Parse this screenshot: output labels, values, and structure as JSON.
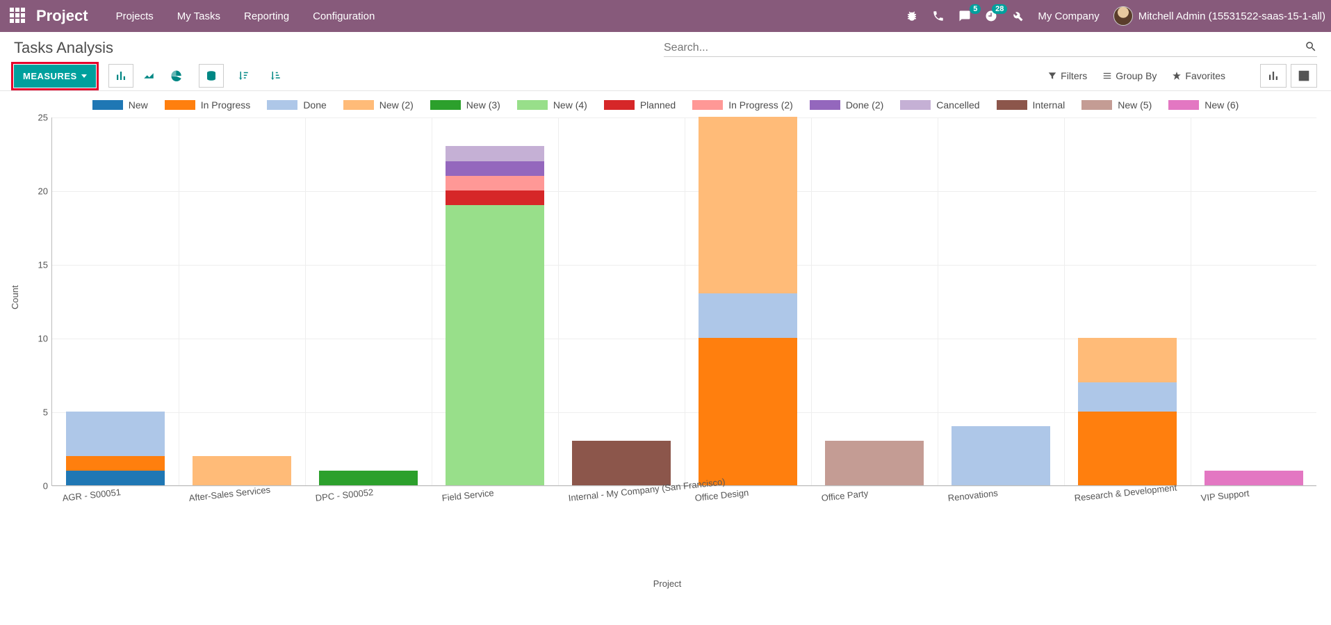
{
  "app": {
    "brand": "Project",
    "menu": [
      "Projects",
      "My Tasks",
      "Reporting",
      "Configuration"
    ],
    "systray": {
      "messaging_badge": "5",
      "activities_badge": "28",
      "company": "My Company",
      "user": "Mitchell Admin (15531522-saas-15-1-all)"
    }
  },
  "breadcrumb": "Tasks Analysis",
  "search": {
    "placeholder": "Search..."
  },
  "controls": {
    "measures_label": "MEASURES",
    "filters": "Filters",
    "groupby": "Group By",
    "favorites": "Favorites"
  },
  "legend_colors": {
    "New": "#1f77b4",
    "In Progress": "#ff7f0e",
    "Done": "#aec7e8",
    "New (2)": "#ffbb78",
    "New (3)": "#2ca02c",
    "New (4)": "#98df8a",
    "Planned": "#d62728",
    "In Progress (2)": "#ff9896",
    "Done (2)": "#9467bd",
    "Cancelled": "#c5b0d5",
    "Internal": "#8c564b",
    "New (5)": "#c49c94",
    "New (6)": "#e377c2"
  },
  "chart_data": {
    "type": "bar",
    "stacked": true,
    "xlabel": "Project",
    "ylabel": "Count",
    "ylim": [
      0,
      25
    ],
    "yticks": [
      0,
      5,
      10,
      15,
      20,
      25
    ],
    "categories": [
      "AGR - S00051",
      "After-Sales Services",
      "DPC - S00052",
      "Field Service",
      "Internal - My Company (San Francisco)",
      "Office Design",
      "Office Party",
      "Renovations",
      "Research & Development",
      "VIP Support"
    ],
    "legend_order": [
      "New",
      "In Progress",
      "Done",
      "New (2)",
      "New (3)",
      "New (4)",
      "Planned",
      "In Progress (2)",
      "Done (2)",
      "Cancelled",
      "Internal",
      "New (5)",
      "New (6)"
    ],
    "stacks": [
      [
        {
          "series": "New",
          "value": 1
        },
        {
          "series": "In Progress",
          "value": 1
        },
        {
          "series": "Done",
          "value": 3
        }
      ],
      [
        {
          "series": "New (2)",
          "value": 2
        }
      ],
      [
        {
          "series": "New (3)",
          "value": 1
        }
      ],
      [
        {
          "series": "New (4)",
          "value": 19
        },
        {
          "series": "Planned",
          "value": 1
        },
        {
          "series": "In Progress (2)",
          "value": 1
        },
        {
          "series": "Done (2)",
          "value": 1
        },
        {
          "series": "Cancelled",
          "value": 1
        }
      ],
      [
        {
          "series": "Internal",
          "value": 3
        }
      ],
      [
        {
          "series": "In Progress",
          "value": 10
        },
        {
          "series": "Done",
          "value": 3
        },
        {
          "series": "New (2)",
          "value": 12
        }
      ],
      [
        {
          "series": "New (5)",
          "value": 3
        }
      ],
      [
        {
          "series": "Done",
          "value": 4
        }
      ],
      [
        {
          "series": "In Progress",
          "value": 5
        },
        {
          "series": "Done",
          "value": 2
        },
        {
          "series": "New (2)",
          "value": 3
        }
      ],
      [
        {
          "series": "New (6)",
          "value": 1
        }
      ]
    ]
  }
}
